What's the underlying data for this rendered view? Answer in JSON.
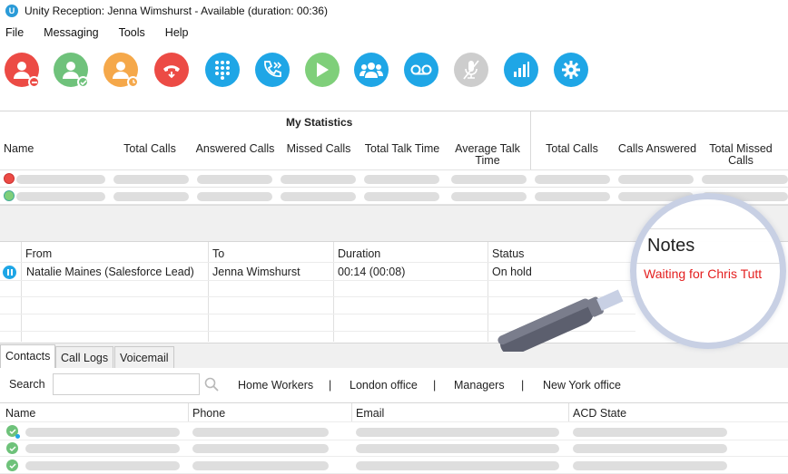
{
  "window": {
    "app_icon_letter": "U",
    "title": "Unity Reception: Jenna Wimshurst - Available (duration: 00:36)"
  },
  "menu": [
    "File",
    "Messaging",
    "Tools",
    "Help"
  ],
  "toolbar": {
    "icons": [
      "dnd-icon",
      "available-icon",
      "away-icon",
      "hangup-icon",
      "dialpad-icon",
      "transfer-icon",
      "play-icon",
      "conference-icon",
      "voicemail-icon",
      "mute-icon",
      "statistics-icon",
      "settings-icon"
    ],
    "colors": {
      "red": "#ec4b45",
      "green": "#6fc27b",
      "orange": "#f5a84a",
      "blue": "#1fa6e6",
      "lightgreen": "#7fcf7a",
      "grey": "#cdcdcd"
    }
  },
  "statistics": {
    "section_title": "My Statistics",
    "columns": [
      "Name",
      "Total Calls",
      "Answered Calls",
      "Missed Calls",
      "Total Talk Time",
      "Average Talk Time",
      "Total Calls",
      "Calls Answered",
      "Total Missed Calls"
    ]
  },
  "calls": {
    "columns": [
      "From",
      "To",
      "Duration",
      "Status"
    ],
    "rows": [
      {
        "from": "Natalie Maines (Salesforce Lead)",
        "to": "Jenna Wimshurst",
        "duration": "00:14 (00:08)",
        "status": "On hold"
      }
    ]
  },
  "notes": {
    "header": "Notes",
    "text": "Waiting for Chris Tutt"
  },
  "tabs": [
    "Contacts",
    "Call Logs",
    "Voicemail"
  ],
  "search": {
    "label": "Search",
    "value": "",
    "groups": [
      "Home Workers",
      "London office",
      "Managers",
      "New York office"
    ],
    "separator": "|"
  },
  "contacts": {
    "columns": [
      "Name",
      "Phone",
      "Email",
      "ACD State"
    ]
  }
}
